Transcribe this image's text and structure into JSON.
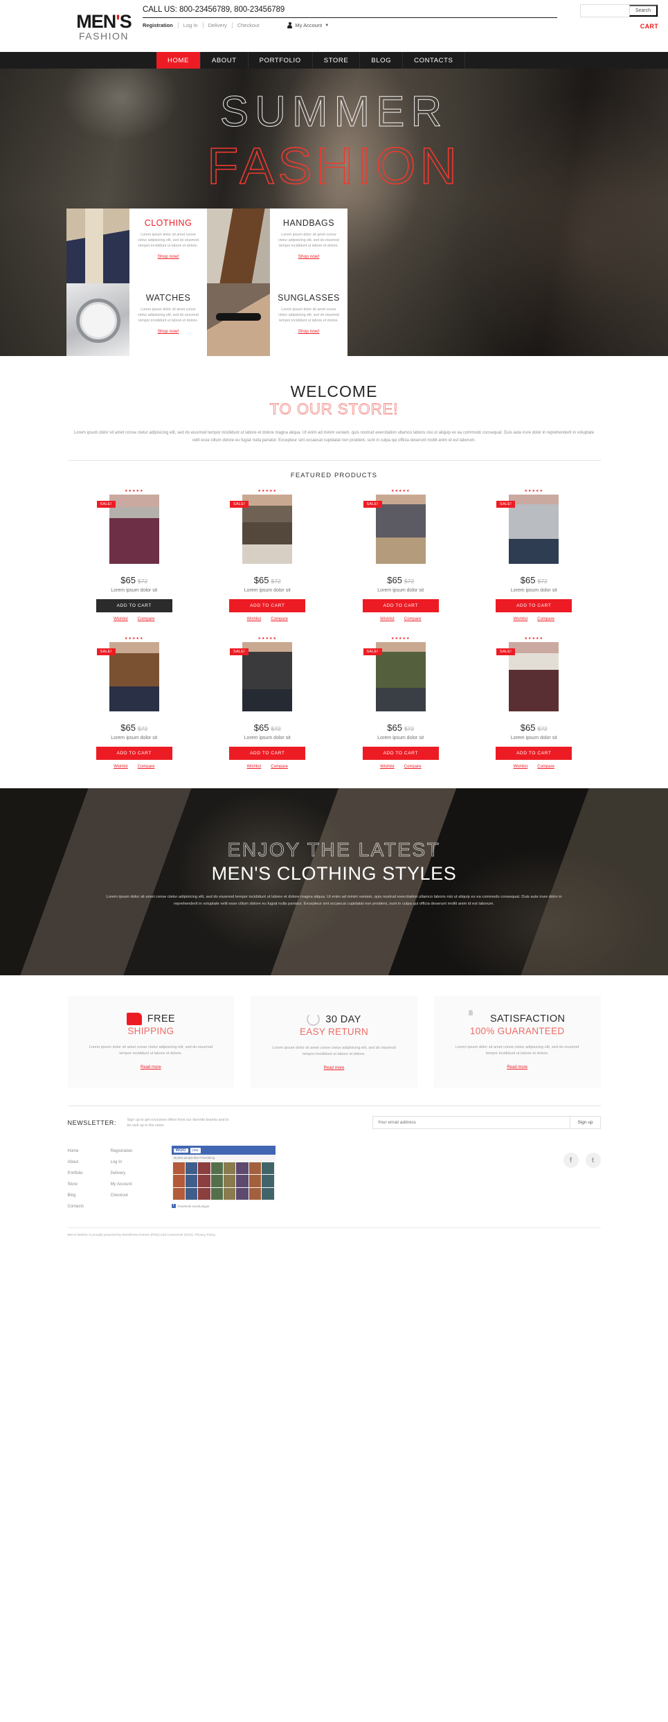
{
  "header": {
    "logo_main": "MEN",
    "logo_apos": "'",
    "logo_main2": "S",
    "logo_sub": "FASHION",
    "call_us": "CALL US: 800-23456789, 800-23456789",
    "links": [
      "Registration",
      "Log In",
      "Delivery",
      "Checkout"
    ],
    "my_account": "My Account",
    "cart": "CART",
    "search_placeholder": "",
    "search_value": "",
    "search_button": "Search"
  },
  "nav": {
    "items": [
      {
        "label": "HOME",
        "active": true
      },
      {
        "label": "ABOUT",
        "active": false
      },
      {
        "label": "PORTFOLIO",
        "active": false
      },
      {
        "label": "STORE",
        "active": false
      },
      {
        "label": "BLOG",
        "active": false
      },
      {
        "label": "CONTACTS",
        "active": false
      }
    ]
  },
  "hero": {
    "line1": "SUMMER",
    "line2": "FASHION"
  },
  "categories": {
    "desc": "Lorem ipsum dolor sit amet conse ctetur adipisicing elit, sed do eiusmod tempor incididunt ut labore et dolore.",
    "shop_now": "Shop now!",
    "items": [
      {
        "title": "CLOTHING",
        "accent": true
      },
      {
        "title": "HANDBAGS",
        "accent": false
      },
      {
        "title": "WATCHES",
        "accent": false
      },
      {
        "title": "SUNGLASSES",
        "accent": false
      }
    ]
  },
  "welcome": {
    "title": "WELCOME",
    "subtitle": "TO OUR STORE!",
    "body": "Lorem ipsum dolor sit amet conse ctetur adipisicing elit, sed do eiusmod tempor incididunt ut labore et dolore magna aliqua. Ut enim ad minim veniam, quis nostrud exercitation ullamco laboris nisi ut aliquip ex ea commodo consequat. Duis aute irure dolor in reprehenderit in voluptate velit esse cillum dolore eu fugiat nulla pariatur. Excepteur sint occaecat cupidatat non proident, sunt in culpa qui officia deserunt mollit anim id est laborum."
  },
  "featured": {
    "heading": "FEATURED PRODUCTS",
    "sale_badge": "SALE!",
    "stars": "★★★★★",
    "add_to_cart": "ADD TO CART",
    "wishlist": "Wishlist",
    "compare": "Compare",
    "products": [
      {
        "price": "$65",
        "old_price": "$72",
        "name": "Lorem ipsum dolor sit",
        "dark_button": true
      },
      {
        "price": "$65",
        "old_price": "$72",
        "name": "Lorem ipsum dolor sit",
        "dark_button": false
      },
      {
        "price": "$65",
        "old_price": "$72",
        "name": "Lorem ipsum dolor sit",
        "dark_button": false
      },
      {
        "price": "$65",
        "old_price": "$72",
        "name": "Lorem ipsum dolor sit",
        "dark_button": false
      },
      {
        "price": "$65",
        "old_price": "$72",
        "name": "Lorem ipsum dolor sit",
        "dark_button": false
      },
      {
        "price": "$65",
        "old_price": "$72",
        "name": "Lorem ipsum dolor sit",
        "dark_button": false
      },
      {
        "price": "$65",
        "old_price": "$72",
        "name": "Lorem ipsum dolor sit",
        "dark_button": false
      },
      {
        "price": "$65",
        "old_price": "$72",
        "name": "Lorem ipsum dolor sit",
        "dark_button": false
      }
    ]
  },
  "parallax": {
    "line1": "ENJOY THE LATEST",
    "line2": "MEN'S CLOTHING STYLES",
    "body": "Lorem ipsum dolor sit amet conse ctetur adipisicing elit, sed do eiusmod tempor incididunt ut labore et dolore magna aliqua. Ut enim ad minim veniam, quis nostrud exercitation ullamco laboris nisi ut aliquip ex ea commodo consequat. Duis aute irure dolor in reprehenderit in voluptate velit esse cillum dolore eu fugiat nulla pariatur. Excepteur sint occaecat cupidatat non proident, sunt in culpa qui officia deserunt mollit anim id est laborum."
  },
  "services": {
    "read_more": "Read more",
    "body": "Lorem ipsum dolor sit amet conse ctetur adipisicing elit, sed do eiusmod tempor incididunt ut labore et dolore.",
    "items": [
      {
        "icon": "truck-icon",
        "title1": "FREE",
        "title2": "SHIPPING"
      },
      {
        "icon": "return-arrow-icon",
        "title1": "30 DAY",
        "title2": "EASY RETURN"
      },
      {
        "icon": "thumbs-up-icon",
        "title1": "SATISFACTION",
        "title2": "100% GUARANTEED"
      }
    ]
  },
  "newsletter": {
    "label": "NEWSLETTER:",
    "copy": "Sign up to get exclusive offers from our favorite brands and to be well up in the news",
    "placeholder": "Your email address",
    "value": "",
    "button": "Sign up"
  },
  "footer": {
    "col1": [
      "Home",
      "About",
      "Portfolio",
      "Store",
      "Blog",
      "Contacts"
    ],
    "col2": [
      "Registration",
      "Log In",
      "Delivery",
      "My Account",
      "Checkout"
    ],
    "facebook": {
      "logo": "WOO",
      "like": "Like",
      "stats": "45,562 people like FreeckDog",
      "page_link": "Facebook social plugin"
    },
    "socials": [
      {
        "name": "facebook-icon",
        "glyph": "f"
      },
      {
        "name": "twitter-icon",
        "glyph": "t"
      }
    ],
    "copyright": "Men's fashion is proudly powered by WordPress Entries (RSS) and Comments (RSS). Privacy Policy"
  },
  "colors": {
    "accent": "#ed1c24",
    "dark": "#1c1c1c",
    "muted": "#9a9a9a"
  }
}
